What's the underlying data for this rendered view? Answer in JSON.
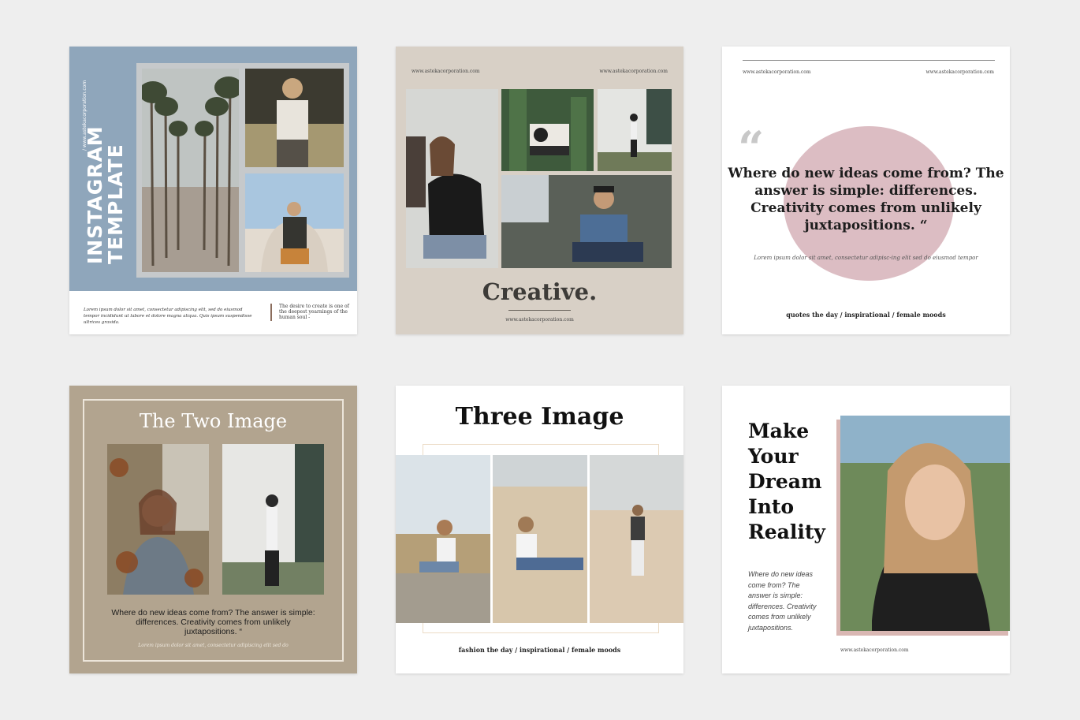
{
  "card1": {
    "title": "INSTAGRAM TEMPLATE",
    "url": "/ www.astekacorporation.com",
    "lorem": "Lorem ipsum dolor sit amet, consectetur adipiscing elit, sed do eiusmod tempor incididunt ut labore et dolore magna aliqua. Quis ipsum suspendisse ultrices gravida.",
    "quote": "The desire to create is one of the deepest yearnings of the human soul -"
  },
  "card2": {
    "url_left": "www.astekacorporation.com",
    "url_right": "www.astekacorporation.com",
    "title": "Creative.",
    "url_bottom": "www.astekacorporation.com"
  },
  "card3": {
    "url_left": "www.astekacorporation.com",
    "url_right": "www.astekacorporation.com",
    "quote_mark": "“",
    "quote": "Where do new ideas come from? The answer is simple: differences. Creativity comes from unlikely juxtapositions. “",
    "lorem": "Lorem ipsum dolor sit amet, consectetur adipisc-ing elit sed do eiusmod tempor",
    "tagline": "quotes the day / inspirational / female moods"
  },
  "card4": {
    "title": "The Two Image",
    "quote": "Where do new ideas come from? The answer is simple: differences. Creativity comes from unlikely juxtapositions. “",
    "lorem": "Lorem ipsum dolor sit amet, consectetur adipiscing elit sed do"
  },
  "card5": {
    "title": "Three Image",
    "tagline": "fashion the day / inspirational / female moods"
  },
  "card6": {
    "title": "Make Your Dream Into Reality",
    "body": "Where do new ideas come from? The answer is simple: differences. Creativity comes from unlikely juxtapositions.",
    "url": "www.astekacorporation.com"
  }
}
